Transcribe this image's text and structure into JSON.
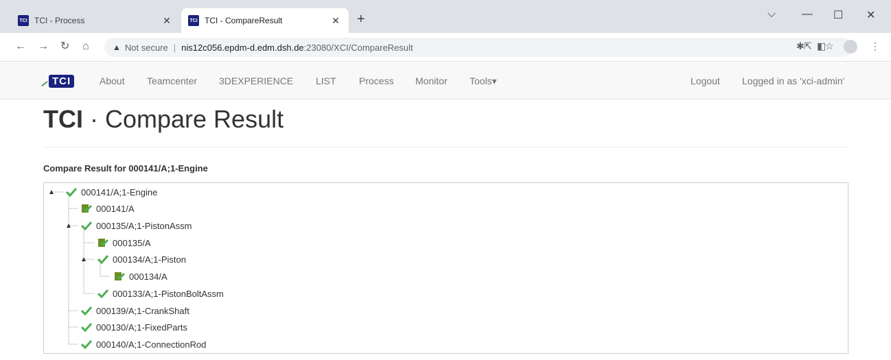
{
  "browser": {
    "tabs": [
      {
        "icon_text": "TCI",
        "title": "TCI - Process",
        "active": false
      },
      {
        "icon_text": "TCI",
        "title": "TCI - CompareResult",
        "active": true
      }
    ],
    "new_tab": "+",
    "controls": {
      "collapse": "⌵",
      "minimize": "—",
      "maximize": "☐",
      "close": "✕"
    },
    "address": {
      "security_label": "Not secure",
      "host": "nis12c056.epdm-d.edm.dsh.de",
      "path": ":23080/XCI/CompareResult"
    }
  },
  "navbar": {
    "brand_text": "TCI",
    "links": [
      "About",
      "Teamcenter",
      "3DEXPERIENCE",
      "LIST",
      "Process",
      "Monitor",
      "Tools▾"
    ],
    "logout": "Logout",
    "user": "Logged in as 'xci-admin'"
  },
  "page": {
    "title_strong": "TCI",
    "title_rest": " · Compare Result",
    "section_title": "Compare Result for 000141/A;1-Engine"
  },
  "tree": [
    {
      "label": "000141/A;1-Engine",
      "icon": "check-icon"
    },
    {
      "label": "000141/A",
      "icon": "document-check-icon"
    },
    {
      "label": "000135/A;1-PistonAssm",
      "icon": "check-icon"
    },
    {
      "label": "000135/A",
      "icon": "document-check-icon"
    },
    {
      "label": "000134/A;1-Piston",
      "icon": "check-icon"
    },
    {
      "label": "000134/A",
      "icon": "document-check-icon"
    },
    {
      "label": "000133/A;1-PistonBoltAssm",
      "icon": "check-icon"
    },
    {
      "label": "000139/A;1-CrankShaft",
      "icon": "check-icon"
    },
    {
      "label": "000130/A;1-FixedParts",
      "icon": "check-icon"
    },
    {
      "label": "000140/A;1-ConnectionRod",
      "icon": "check-icon"
    }
  ],
  "colors": {
    "check": "#4caf50",
    "brand": "#1a237e"
  }
}
